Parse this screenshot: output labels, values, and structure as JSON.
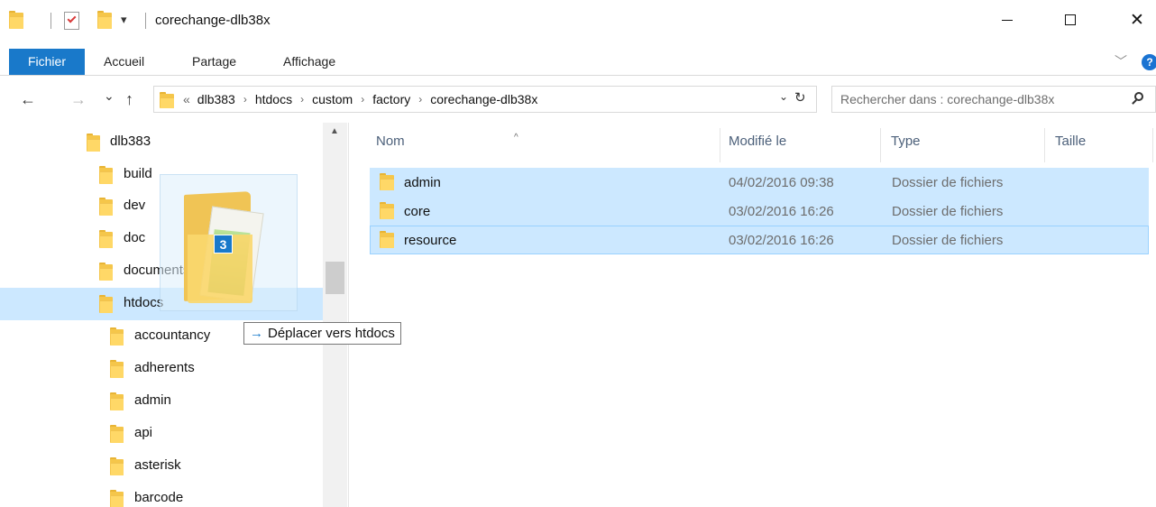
{
  "window": {
    "title": "corechange-dlb38x",
    "minimize_glyph": "—",
    "maximize_glyph": "□",
    "close_glyph": "✕"
  },
  "quick_access": {
    "customize_glyph": "▾"
  },
  "ribbon": {
    "tabs": [
      "Fichier",
      "Accueil",
      "Partage",
      "Affichage"
    ],
    "expand_glyph": "﹀",
    "help_glyph": "?"
  },
  "nav": {
    "back_glyph": "←",
    "forward_glyph": "→",
    "recent_glyph": "⌄",
    "up_glyph": "↑",
    "overflow_glyph": "«",
    "breadcrumbs": [
      "dlb383",
      "htdocs",
      "custom",
      "factory",
      "corechange-dlb38x"
    ],
    "crumb_separator": "›",
    "address_dropdown_glyph": "⌄",
    "refresh_glyph": "↻",
    "search_placeholder": "Rechercher dans : corechange-dlb38x"
  },
  "tree": {
    "items": [
      {
        "label": "dlb383",
        "level": 0
      },
      {
        "label": "build",
        "level": 1
      },
      {
        "label": "dev",
        "level": 1
      },
      {
        "label": "doc",
        "level": 1
      },
      {
        "label": "documents",
        "level": 1
      },
      {
        "label": "htdocs",
        "level": 1,
        "hover": true
      },
      {
        "label": "accountancy",
        "level": 2
      },
      {
        "label": "adherents",
        "level": 2
      },
      {
        "label": "admin",
        "level": 2
      },
      {
        "label": "api",
        "level": 2
      },
      {
        "label": "asterisk",
        "level": 2
      },
      {
        "label": "barcode",
        "level": 2
      }
    ],
    "scroll_up_glyph": "▲"
  },
  "list": {
    "columns": [
      "Nom",
      "Modifié le",
      "Type",
      "Taille"
    ],
    "sort_glyph": "^",
    "rows": [
      {
        "name": "admin",
        "modified": "04/02/2016 09:38",
        "type": "Dossier de fichiers",
        "size": ""
      },
      {
        "name": "core",
        "modified": "03/02/2016 16:26",
        "type": "Dossier de fichiers",
        "size": ""
      },
      {
        "name": "resource",
        "modified": "03/02/2016 16:26",
        "type": "Dossier de fichiers",
        "size": ""
      }
    ]
  },
  "drag": {
    "count": "3",
    "tooltip_arrow": "→",
    "tooltip_text": "Déplacer vers htdocs"
  },
  "colors": {
    "accent": "#1979ca",
    "selection": "#cce8ff",
    "folder": "#f5c64a"
  }
}
